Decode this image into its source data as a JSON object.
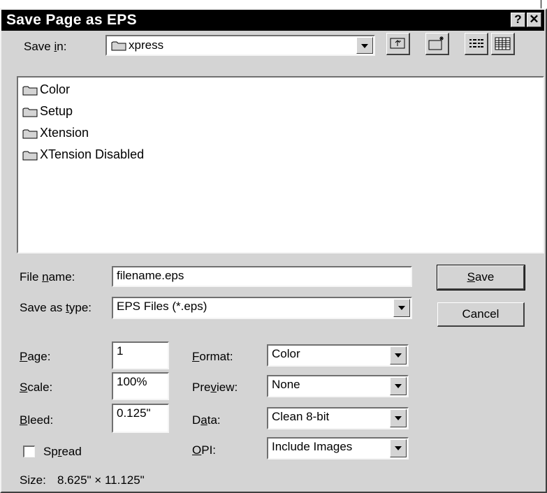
{
  "window": {
    "title": "Save Page as EPS",
    "help_label": "?",
    "close_label": "✕"
  },
  "save_in": {
    "label_pre": "Save ",
    "label_key": "i",
    "label_post": "n:",
    "value": "xpress"
  },
  "toolbar": {
    "up_icon": "up-folder-icon",
    "new_icon": "new-folder-icon",
    "list_icon": "list-view-icon",
    "details_icon": "details-view-icon"
  },
  "file_list": {
    "items": [
      {
        "name": "Color"
      },
      {
        "name": "Setup"
      },
      {
        "name": "Xtension"
      },
      {
        "name": "XTension Disabled"
      }
    ]
  },
  "file_name": {
    "label_pre": "File ",
    "label_key": "n",
    "label_post": "ame:",
    "value": "filename.eps"
  },
  "save_as_type": {
    "label_pre": "Save as ",
    "label_key": "t",
    "label_post": "ype:",
    "value": "EPS Files (*.eps)"
  },
  "buttons": {
    "save_key": "S",
    "save_rest": "ave",
    "cancel": "Cancel"
  },
  "page": {
    "label_key": "P",
    "label_rest": "age:",
    "value": "1"
  },
  "scale": {
    "label_key": "S",
    "label_rest": "cale:",
    "value": "100%"
  },
  "bleed": {
    "label_key": "B",
    "label_rest": "leed:",
    "value": "0.125\""
  },
  "format": {
    "label_key": "F",
    "label_rest": "ormat:",
    "value": "Color"
  },
  "preview": {
    "label_pre": "Pre",
    "label_key": "v",
    "label_post": "iew:",
    "value": "None"
  },
  "data_field": {
    "label_pre": "D",
    "label_key": "a",
    "label_post": "ta:",
    "value": "Clean 8-bit"
  },
  "opi": {
    "label_key": "O",
    "label_rest": "PI:",
    "value": "Include Images"
  },
  "spread": {
    "label_pre": "Sp",
    "label_key": "r",
    "label_post": "ead",
    "checked": false
  },
  "size": {
    "label": "Size:",
    "value": "8.625\" × 11.125\""
  }
}
